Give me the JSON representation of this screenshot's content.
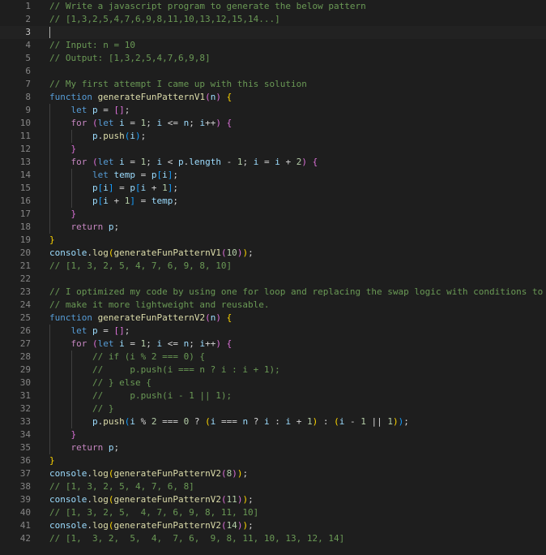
{
  "editor": {
    "active_line": 3,
    "lines": [
      {
        "n": "1",
        "tokens": [
          [
            "comment",
            "// Write a javascript program to generate the below pattern"
          ]
        ]
      },
      {
        "n": "2",
        "tokens": [
          [
            "comment",
            "// [1,3,2,5,4,7,6,9,8,11,10,13,12,15,14...]"
          ]
        ]
      },
      {
        "n": "3",
        "cursor": true,
        "tokens": []
      },
      {
        "n": "4",
        "tokens": [
          [
            "comment",
            "// Input: n = 10"
          ]
        ]
      },
      {
        "n": "5",
        "tokens": [
          [
            "comment",
            "// Output: [1,3,2,5,4,7,6,9,8]"
          ]
        ]
      },
      {
        "n": "6",
        "tokens": []
      },
      {
        "n": "7",
        "tokens": [
          [
            "comment",
            "// My first attempt I came up with this solution"
          ]
        ]
      },
      {
        "n": "8",
        "tokens": [
          [
            "keyword",
            "function "
          ],
          [
            "function",
            "generateFunPatternV1"
          ],
          [
            "brace2",
            "("
          ],
          [
            "variable",
            "n"
          ],
          [
            "brace2",
            ")"
          ],
          [
            "plain",
            " "
          ],
          [
            "brace1",
            "{"
          ]
        ]
      },
      {
        "n": "9",
        "tokens": [
          [
            "plain",
            "    "
          ],
          [
            "keyword",
            "let "
          ],
          [
            "variable",
            "p"
          ],
          [
            "plain",
            " = "
          ],
          [
            "brace2",
            "[]"
          ],
          [
            "plain",
            ";"
          ]
        ]
      },
      {
        "n": "10",
        "tokens": [
          [
            "plain",
            "    "
          ],
          [
            "control",
            "for "
          ],
          [
            "brace2",
            "("
          ],
          [
            "keyword",
            "let "
          ],
          [
            "variable",
            "i"
          ],
          [
            "plain",
            " = "
          ],
          [
            "number",
            "1"
          ],
          [
            "plain",
            "; "
          ],
          [
            "variable",
            "i"
          ],
          [
            "plain",
            " <= "
          ],
          [
            "variable",
            "n"
          ],
          [
            "plain",
            "; "
          ],
          [
            "variable",
            "i"
          ],
          [
            "plain",
            "++"
          ],
          [
            "brace2",
            ")"
          ],
          [
            "plain",
            " "
          ],
          [
            "brace2",
            "{"
          ]
        ]
      },
      {
        "n": "11",
        "tokens": [
          [
            "plain",
            "        "
          ],
          [
            "variable",
            "p"
          ],
          [
            "plain",
            "."
          ],
          [
            "function",
            "push"
          ],
          [
            "brace3",
            "("
          ],
          [
            "variable",
            "i"
          ],
          [
            "brace3",
            ")"
          ],
          [
            "plain",
            ";"
          ]
        ]
      },
      {
        "n": "12",
        "tokens": [
          [
            "plain",
            "    "
          ],
          [
            "brace2",
            "}"
          ]
        ]
      },
      {
        "n": "13",
        "tokens": [
          [
            "plain",
            "    "
          ],
          [
            "control",
            "for "
          ],
          [
            "brace2",
            "("
          ],
          [
            "keyword",
            "let "
          ],
          [
            "variable",
            "i"
          ],
          [
            "plain",
            " = "
          ],
          [
            "number",
            "1"
          ],
          [
            "plain",
            "; "
          ],
          [
            "variable",
            "i"
          ],
          [
            "plain",
            " < "
          ],
          [
            "variable",
            "p"
          ],
          [
            "plain",
            "."
          ],
          [
            "variable",
            "length"
          ],
          [
            "plain",
            " - "
          ],
          [
            "number",
            "1"
          ],
          [
            "plain",
            "; "
          ],
          [
            "variable",
            "i"
          ],
          [
            "plain",
            " = "
          ],
          [
            "variable",
            "i"
          ],
          [
            "plain",
            " + "
          ],
          [
            "number",
            "2"
          ],
          [
            "brace2",
            ")"
          ],
          [
            "plain",
            " "
          ],
          [
            "brace2",
            "{"
          ]
        ]
      },
      {
        "n": "14",
        "tokens": [
          [
            "plain",
            "        "
          ],
          [
            "keyword",
            "let "
          ],
          [
            "variable",
            "temp"
          ],
          [
            "plain",
            " = "
          ],
          [
            "variable",
            "p"
          ],
          [
            "brace3",
            "["
          ],
          [
            "variable",
            "i"
          ],
          [
            "brace3",
            "]"
          ],
          [
            "plain",
            ";"
          ]
        ]
      },
      {
        "n": "15",
        "tokens": [
          [
            "plain",
            "        "
          ],
          [
            "variable",
            "p"
          ],
          [
            "brace3",
            "["
          ],
          [
            "variable",
            "i"
          ],
          [
            "brace3",
            "]"
          ],
          [
            "plain",
            " = "
          ],
          [
            "variable",
            "p"
          ],
          [
            "brace3",
            "["
          ],
          [
            "variable",
            "i"
          ],
          [
            "plain",
            " + "
          ],
          [
            "number",
            "1"
          ],
          [
            "brace3",
            "]"
          ],
          [
            "plain",
            ";"
          ]
        ]
      },
      {
        "n": "16",
        "tokens": [
          [
            "plain",
            "        "
          ],
          [
            "variable",
            "p"
          ],
          [
            "brace3",
            "["
          ],
          [
            "variable",
            "i"
          ],
          [
            "plain",
            " + "
          ],
          [
            "number",
            "1"
          ],
          [
            "brace3",
            "]"
          ],
          [
            "plain",
            " = "
          ],
          [
            "variable",
            "temp"
          ],
          [
            "plain",
            ";"
          ]
        ]
      },
      {
        "n": "17",
        "tokens": [
          [
            "plain",
            "    "
          ],
          [
            "brace2",
            "}"
          ]
        ]
      },
      {
        "n": "18",
        "tokens": [
          [
            "plain",
            "    "
          ],
          [
            "control",
            "return "
          ],
          [
            "variable",
            "p"
          ],
          [
            "plain",
            ";"
          ]
        ]
      },
      {
        "n": "19",
        "tokens": [
          [
            "brace1",
            "}"
          ]
        ]
      },
      {
        "n": "20",
        "tokens": [
          [
            "variable",
            "console"
          ],
          [
            "plain",
            "."
          ],
          [
            "function",
            "log"
          ],
          [
            "brace1",
            "("
          ],
          [
            "function",
            "generateFunPatternV1"
          ],
          [
            "brace2",
            "("
          ],
          [
            "number",
            "10"
          ],
          [
            "brace2",
            ")"
          ],
          [
            "brace1",
            ")"
          ],
          [
            "plain",
            ";"
          ]
        ]
      },
      {
        "n": "21",
        "tokens": [
          [
            "comment",
            "// [1, 3, 2, 5, 4, 7, 6, 9, 8, 10]"
          ]
        ]
      },
      {
        "n": "22",
        "tokens": []
      },
      {
        "n": "23",
        "tokens": [
          [
            "comment",
            "// I optimized my code by using one for loop and replacing the swap logic with conditions to"
          ]
        ]
      },
      {
        "n": "24",
        "tokens": [
          [
            "comment",
            "// make it more lightweight and reusable."
          ]
        ]
      },
      {
        "n": "25",
        "tokens": [
          [
            "keyword",
            "function "
          ],
          [
            "function",
            "generateFunPatternV2"
          ],
          [
            "brace2",
            "("
          ],
          [
            "variable",
            "n"
          ],
          [
            "brace2",
            ")"
          ],
          [
            "plain",
            " "
          ],
          [
            "brace1",
            "{"
          ]
        ]
      },
      {
        "n": "26",
        "tokens": [
          [
            "plain",
            "    "
          ],
          [
            "keyword",
            "let "
          ],
          [
            "variable",
            "p"
          ],
          [
            "plain",
            " = "
          ],
          [
            "brace2",
            "[]"
          ],
          [
            "plain",
            ";"
          ]
        ]
      },
      {
        "n": "27",
        "tokens": [
          [
            "plain",
            "    "
          ],
          [
            "control",
            "for "
          ],
          [
            "brace2",
            "("
          ],
          [
            "keyword",
            "let "
          ],
          [
            "variable",
            "i"
          ],
          [
            "plain",
            " = "
          ],
          [
            "number",
            "1"
          ],
          [
            "plain",
            "; "
          ],
          [
            "variable",
            "i"
          ],
          [
            "plain",
            " <= "
          ],
          [
            "variable",
            "n"
          ],
          [
            "plain",
            "; "
          ],
          [
            "variable",
            "i"
          ],
          [
            "plain",
            "++"
          ],
          [
            "brace2",
            ")"
          ],
          [
            "plain",
            " "
          ],
          [
            "brace2",
            "{"
          ]
        ]
      },
      {
        "n": "28",
        "tokens": [
          [
            "plain",
            "        "
          ],
          [
            "comment",
            "// if (i % 2 === 0) {"
          ]
        ]
      },
      {
        "n": "29",
        "tokens": [
          [
            "plain",
            "        "
          ],
          [
            "comment",
            "//     p.push(i === n ? i : i + 1);"
          ]
        ]
      },
      {
        "n": "30",
        "tokens": [
          [
            "plain",
            "        "
          ],
          [
            "comment",
            "// } else {"
          ]
        ]
      },
      {
        "n": "31",
        "tokens": [
          [
            "plain",
            "        "
          ],
          [
            "comment",
            "//     p.push(i - 1 || 1);"
          ]
        ]
      },
      {
        "n": "32",
        "tokens": [
          [
            "plain",
            "        "
          ],
          [
            "comment",
            "// }"
          ]
        ]
      },
      {
        "n": "33",
        "tokens": [
          [
            "plain",
            "        "
          ],
          [
            "variable",
            "p"
          ],
          [
            "plain",
            "."
          ],
          [
            "function",
            "push"
          ],
          [
            "brace3",
            "("
          ],
          [
            "variable",
            "i"
          ],
          [
            "plain",
            " % "
          ],
          [
            "number",
            "2"
          ],
          [
            "plain",
            " === "
          ],
          [
            "number",
            "0"
          ],
          [
            "plain",
            " ? "
          ],
          [
            "brace1",
            "("
          ],
          [
            "variable",
            "i"
          ],
          [
            "plain",
            " === "
          ],
          [
            "variable",
            "n"
          ],
          [
            "plain",
            " ? "
          ],
          [
            "variable",
            "i"
          ],
          [
            "plain",
            " : "
          ],
          [
            "variable",
            "i"
          ],
          [
            "plain",
            " + "
          ],
          [
            "number",
            "1"
          ],
          [
            "brace1",
            ")"
          ],
          [
            "plain",
            " : "
          ],
          [
            "brace1",
            "("
          ],
          [
            "variable",
            "i"
          ],
          [
            "plain",
            " - "
          ],
          [
            "number",
            "1"
          ],
          [
            "plain",
            " || "
          ],
          [
            "number",
            "1"
          ],
          [
            "brace1",
            ")"
          ],
          [
            "brace3",
            ")"
          ],
          [
            "plain",
            ";"
          ]
        ]
      },
      {
        "n": "34",
        "tokens": [
          [
            "plain",
            "    "
          ],
          [
            "brace2",
            "}"
          ]
        ]
      },
      {
        "n": "35",
        "tokens": [
          [
            "plain",
            "    "
          ],
          [
            "control",
            "return "
          ],
          [
            "variable",
            "p"
          ],
          [
            "plain",
            ";"
          ]
        ]
      },
      {
        "n": "36",
        "tokens": [
          [
            "brace1",
            "}"
          ]
        ]
      },
      {
        "n": "37",
        "tokens": [
          [
            "variable",
            "console"
          ],
          [
            "plain",
            "."
          ],
          [
            "function",
            "log"
          ],
          [
            "brace1",
            "("
          ],
          [
            "function",
            "generateFunPatternV2"
          ],
          [
            "brace2",
            "("
          ],
          [
            "number",
            "8"
          ],
          [
            "brace2",
            ")"
          ],
          [
            "brace1",
            ")"
          ],
          [
            "plain",
            ";"
          ]
        ]
      },
      {
        "n": "38",
        "tokens": [
          [
            "comment",
            "// [1, 3, 2, 5, 4, 7, 6, 8]"
          ]
        ]
      },
      {
        "n": "39",
        "tokens": [
          [
            "variable",
            "console"
          ],
          [
            "plain",
            "."
          ],
          [
            "function",
            "log"
          ],
          [
            "brace1",
            "("
          ],
          [
            "function",
            "generateFunPatternV2"
          ],
          [
            "brace2",
            "("
          ],
          [
            "number",
            "11"
          ],
          [
            "brace2",
            ")"
          ],
          [
            "brace1",
            ")"
          ],
          [
            "plain",
            ";"
          ]
        ]
      },
      {
        "n": "40",
        "tokens": [
          [
            "comment",
            "// [1, 3, 2, 5,  4, 7, 6, 9, 8, 11, 10]"
          ]
        ]
      },
      {
        "n": "41",
        "tokens": [
          [
            "variable",
            "console"
          ],
          [
            "plain",
            "."
          ],
          [
            "function",
            "log"
          ],
          [
            "brace1",
            "("
          ],
          [
            "function",
            "generateFunPatternV2"
          ],
          [
            "brace2",
            "("
          ],
          [
            "number",
            "14"
          ],
          [
            "brace2",
            ")"
          ],
          [
            "brace1",
            ")"
          ],
          [
            "plain",
            ";"
          ]
        ]
      },
      {
        "n": "42",
        "tokens": [
          [
            "comment",
            "// [1,  3, 2,  5,  4,  7, 6,  9, 8, 11, 10, 13, 12, 14]"
          ]
        ]
      }
    ]
  }
}
